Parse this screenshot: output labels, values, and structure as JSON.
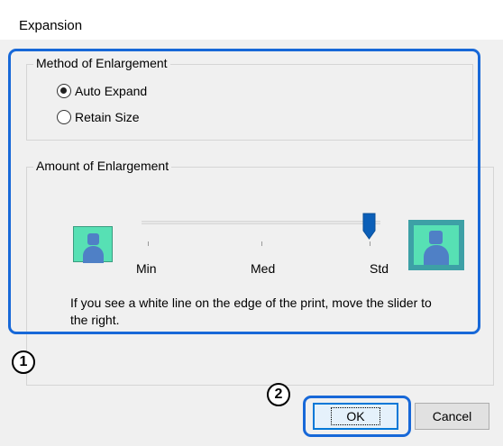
{
  "dialog": {
    "title": "Expansion"
  },
  "method": {
    "group_label": "Method of Enlargement",
    "options": [
      {
        "label": "Auto Expand",
        "checked": true
      },
      {
        "label": "Retain Size",
        "checked": false
      }
    ]
  },
  "amount": {
    "group_label": "Amount of Enlargement",
    "scale_labels": [
      "Min",
      "Med",
      "Std"
    ],
    "slider_value": "Std",
    "hint_text": "If you see a white line on the edge of the print, move the slider to the right."
  },
  "buttons": {
    "ok_label": "OK",
    "cancel_label": "Cancel"
  },
  "callouts": [
    "1",
    "2"
  ],
  "colors": {
    "highlight": "#1768d8",
    "thumbnail_bg": "#57e0b4",
    "person": "#4f80c6",
    "selected_frame": "#3da0a6"
  }
}
